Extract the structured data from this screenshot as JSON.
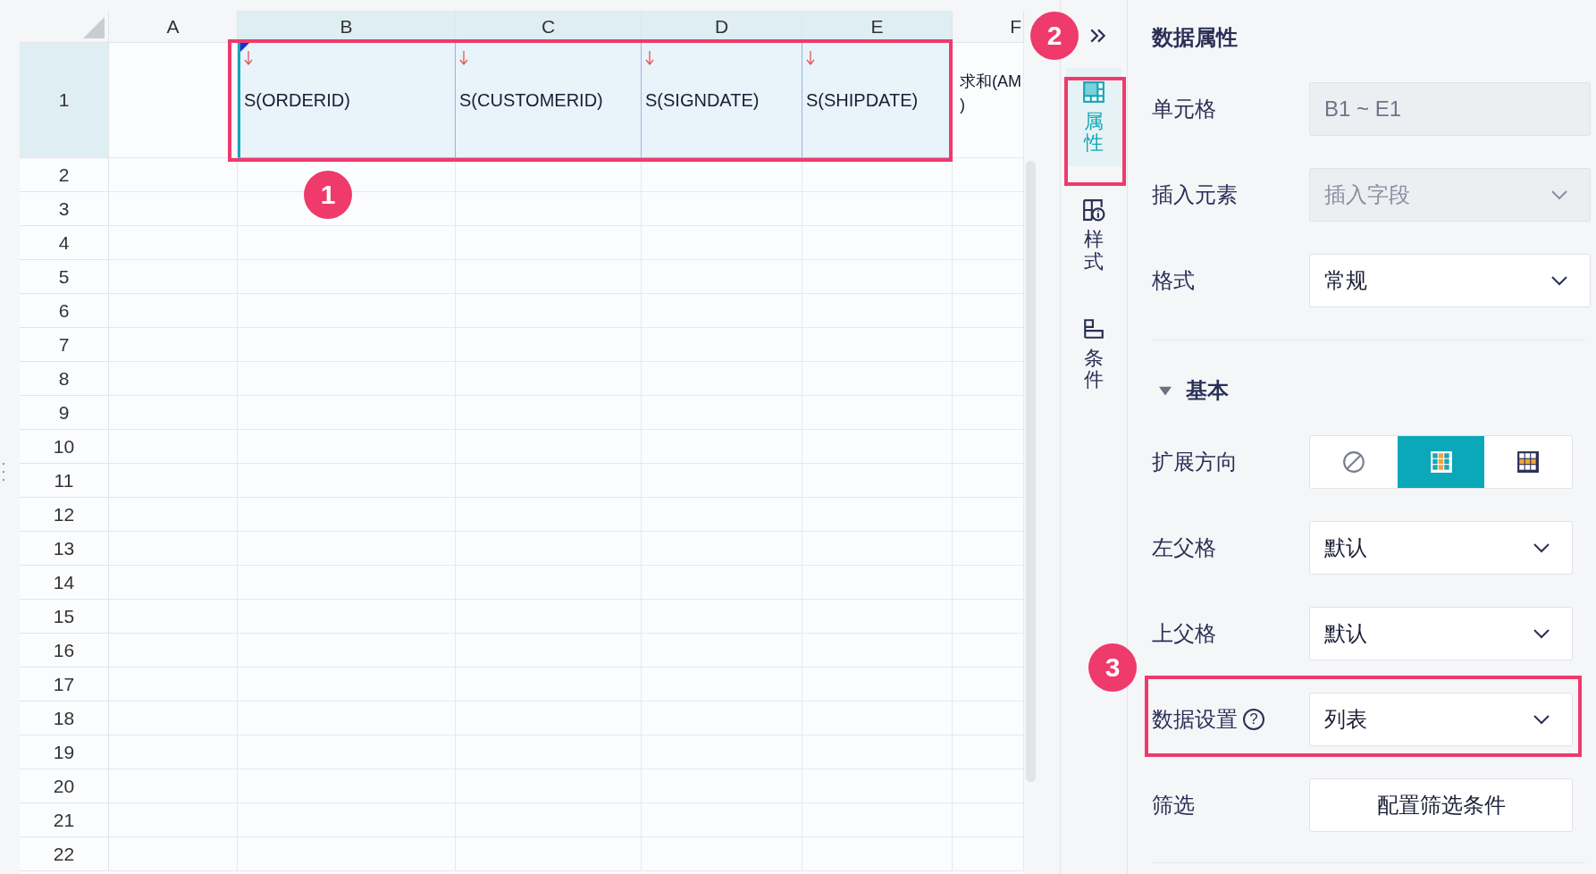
{
  "sheet": {
    "columns": [
      {
        "label": "A",
        "selected": false
      },
      {
        "label": "B",
        "selected": true
      },
      {
        "label": "C",
        "selected": true
      },
      {
        "label": "D",
        "selected": true
      },
      {
        "label": "E",
        "selected": true
      },
      {
        "label": "F",
        "selected": false
      }
    ],
    "rows": [
      {
        "label": "1",
        "selected": true,
        "cells": [
          {
            "kind": "empty"
          },
          {
            "kind": "field",
            "text": "S(ORDERID)",
            "active": true
          },
          {
            "kind": "field",
            "text": "S(CUSTOMERID)",
            "active": false
          },
          {
            "kind": "field",
            "text": "S(SIGNDATE)",
            "active": false
          },
          {
            "kind": "field",
            "text": "S(SHIPDATE)",
            "active": false
          },
          {
            "kind": "text",
            "lines": [
              "求和(AM",
              ")"
            ]
          }
        ]
      },
      {
        "label": "2",
        "selected": false
      },
      {
        "label": "3",
        "selected": false
      },
      {
        "label": "4",
        "selected": false
      },
      {
        "label": "5",
        "selected": false
      },
      {
        "label": "6",
        "selected": false
      },
      {
        "label": "7",
        "selected": false
      },
      {
        "label": "8",
        "selected": false
      },
      {
        "label": "9",
        "selected": false
      },
      {
        "label": "10",
        "selected": false
      },
      {
        "label": "11",
        "selected": false
      },
      {
        "label": "12",
        "selected": false
      },
      {
        "label": "13",
        "selected": false
      },
      {
        "label": "14",
        "selected": false
      },
      {
        "label": "15",
        "selected": false
      },
      {
        "label": "16",
        "selected": false
      },
      {
        "label": "17",
        "selected": false
      },
      {
        "label": "18",
        "selected": false
      },
      {
        "label": "19",
        "selected": false
      },
      {
        "label": "20",
        "selected": false
      },
      {
        "label": "21",
        "selected": false
      },
      {
        "label": "22",
        "selected": false
      }
    ]
  },
  "side_tabs": [
    {
      "label": "属性",
      "kind": "properties",
      "selected": true
    },
    {
      "label": "样式",
      "kind": "style",
      "selected": false
    },
    {
      "label": "条件",
      "kind": "condition",
      "selected": false
    }
  ],
  "panel": {
    "title": "数据属性",
    "fields": [
      {
        "kind": "input",
        "label": "单元格",
        "value": "B1 ~ E1",
        "disabled": true
      },
      {
        "kind": "select",
        "label": "插入元素",
        "placeholder": "插入字段",
        "disabled": true
      },
      {
        "kind": "select",
        "label": "格式",
        "value": "常规",
        "disabled": false
      },
      {
        "kind": "divider"
      },
      {
        "kind": "section",
        "label": "基本",
        "expanded": true
      },
      {
        "kind": "segmented",
        "label": "扩展方向",
        "options": [
          {
            "kind": "none",
            "selected": false
          },
          {
            "kind": "vertical",
            "selected": true
          },
          {
            "kind": "horizontal",
            "selected": false
          }
        ]
      },
      {
        "kind": "select",
        "label": "左父格",
        "value": "默认",
        "disabled": false
      },
      {
        "kind": "select",
        "label": "上父格",
        "value": "默认",
        "disabled": false
      },
      {
        "kind": "select",
        "label": "数据设置",
        "help": "?",
        "value": "列表",
        "disabled": false
      },
      {
        "kind": "button",
        "label": "筛选",
        "button": "配置筛选条件"
      },
      {
        "kind": "divider"
      }
    ]
  },
  "annotations": [
    {
      "label": "1"
    },
    {
      "label": "2"
    },
    {
      "label": "3"
    }
  ]
}
